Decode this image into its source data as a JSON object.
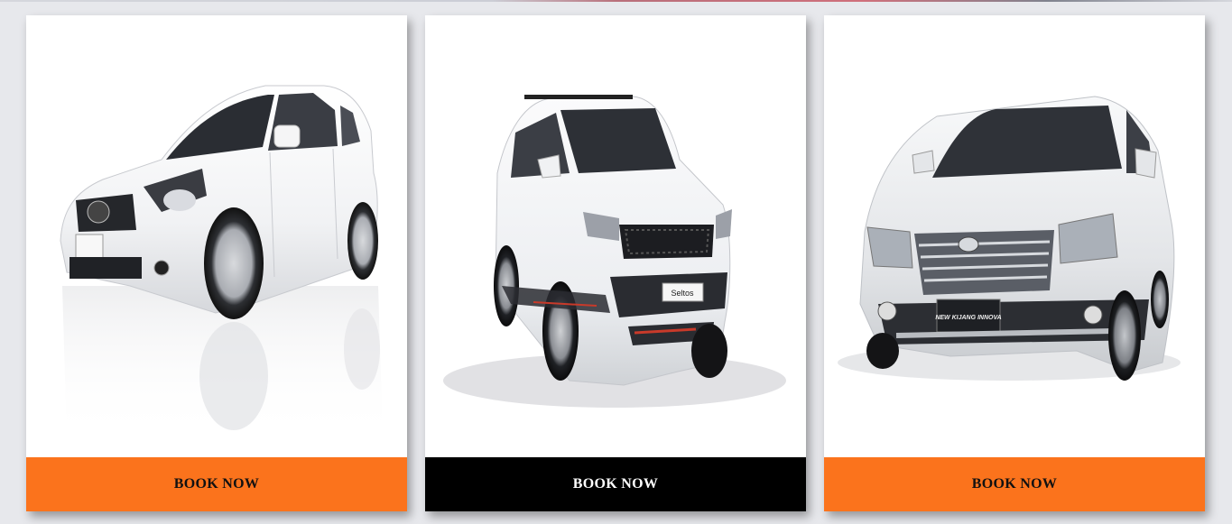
{
  "theme": {
    "orange": "#fb731c",
    "black": "#000000",
    "page_bg": "#e7e8ec",
    "card_bg": "#ffffff"
  },
  "cards": [
    {
      "car_icon": "hatchback-car-image",
      "button_label": "BOOK NOW",
      "button_color": "#fb731c",
      "button_text_color": "#111111"
    },
    {
      "car_icon": "kia-seltos-suv-image",
      "badge": "Seltos",
      "button_label": "BOOK NOW",
      "button_color": "#000000",
      "button_text_color": "#ffffff"
    },
    {
      "car_icon": "toyota-innova-mpv-image",
      "badge": "NEW KIJANG INNOVA",
      "button_label": "BOOK NOW",
      "button_color": "#fb731c",
      "button_text_color": "#111111"
    }
  ]
}
